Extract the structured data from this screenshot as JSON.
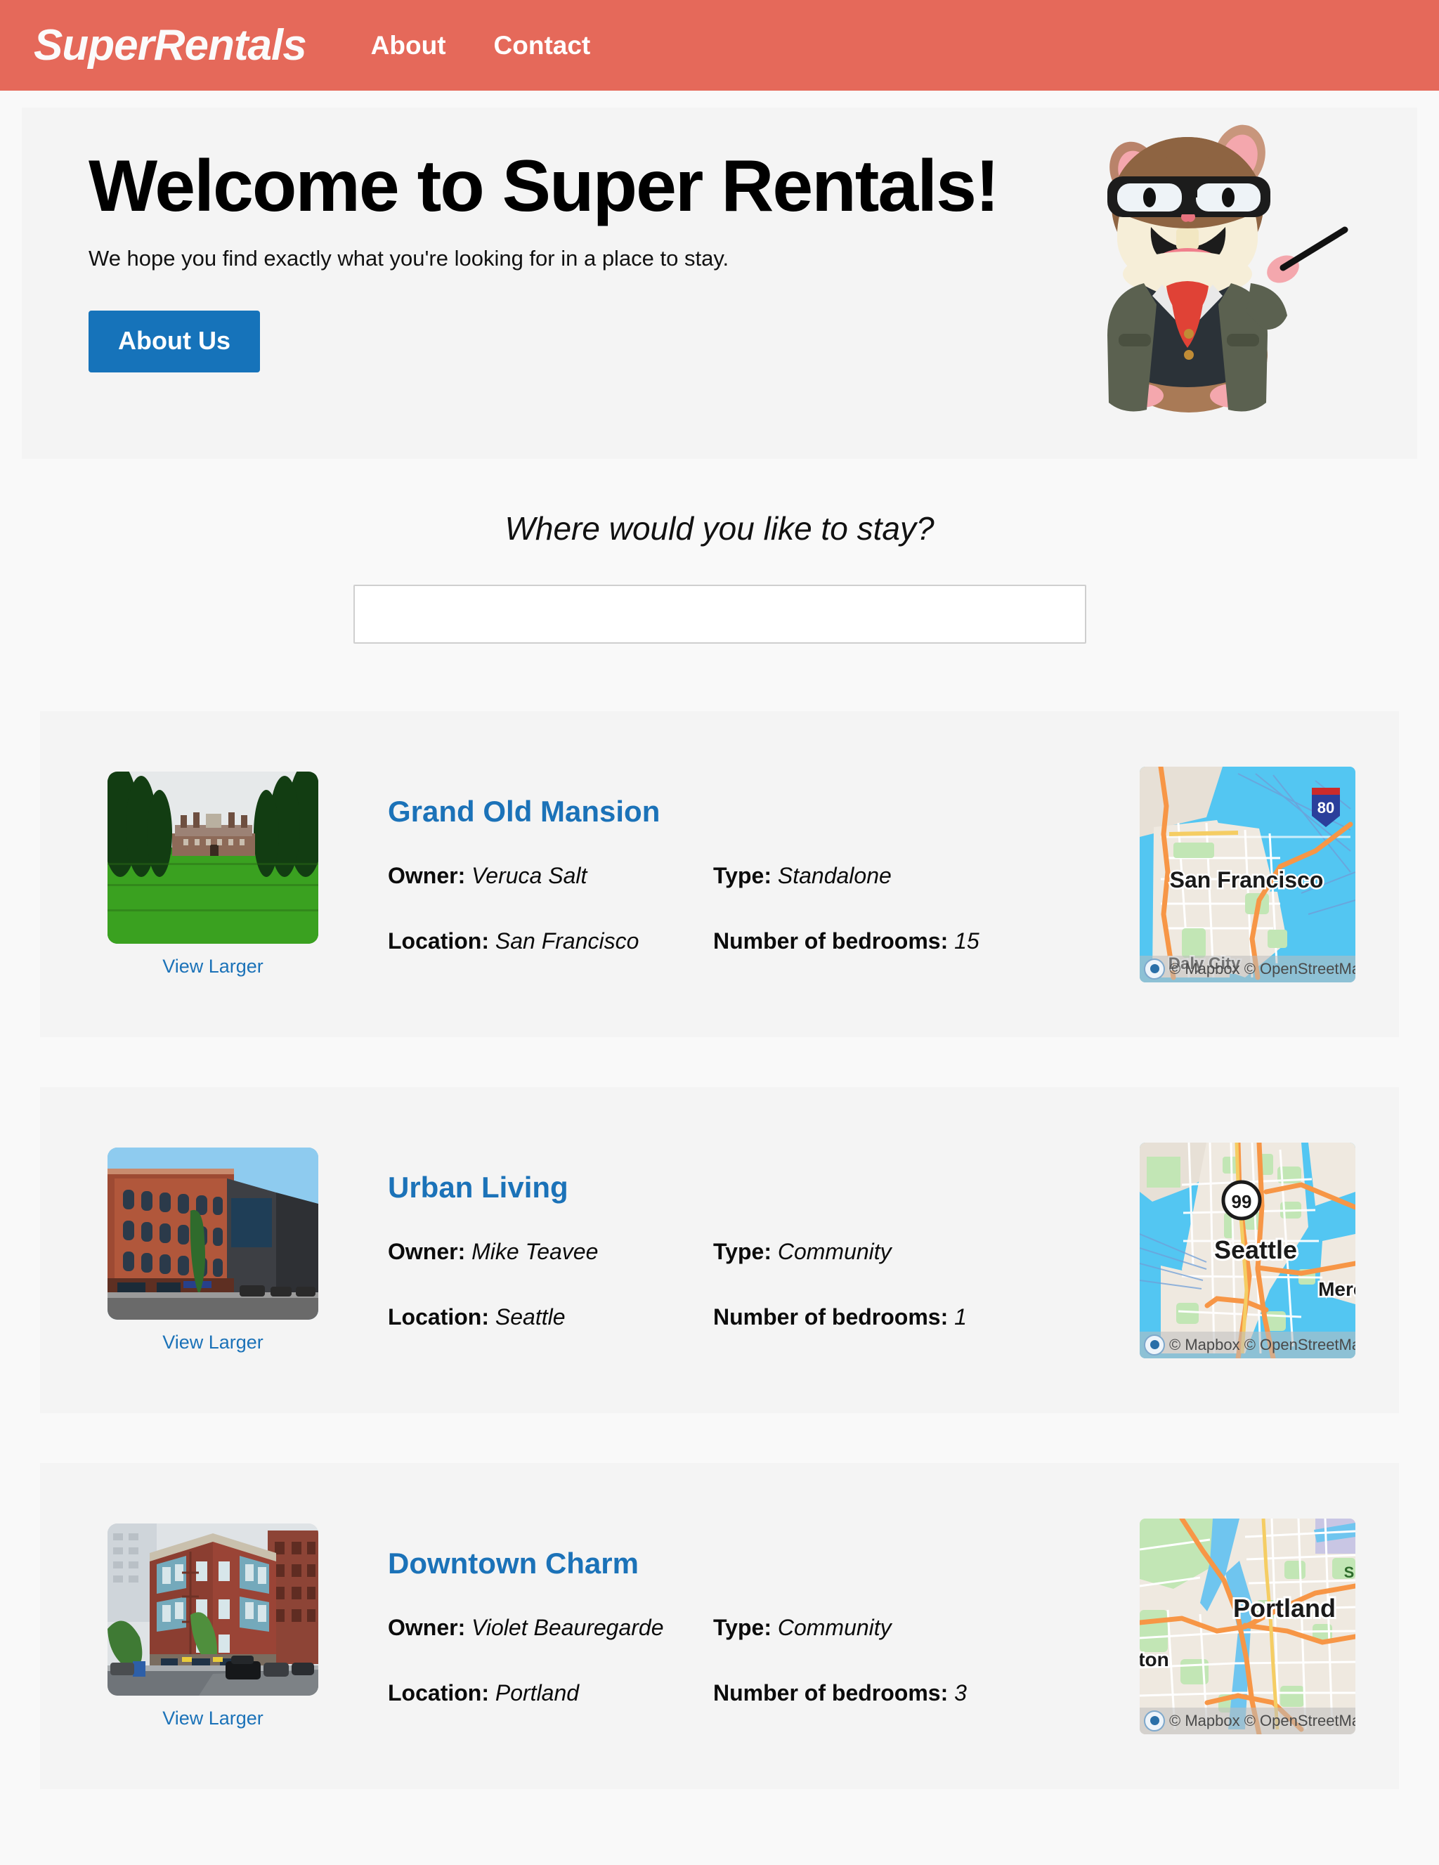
{
  "header": {
    "brand": "SuperRentals",
    "nav": [
      {
        "label": "About",
        "name": "nav-link-about"
      },
      {
        "label": "Contact",
        "name": "nav-link-contact"
      }
    ],
    "background_color": "#e5695a"
  },
  "hero": {
    "title": "Welcome to Super Rentals!",
    "subtitle": "We hope you find exactly what you're looking for in a place to stay.",
    "button_label": "About Us",
    "button_color": "#1673ba",
    "mascot": "tomster-hamster-mascot-icon"
  },
  "search": {
    "title": "Where would you like to stay?",
    "value": "",
    "placeholder": ""
  },
  "labels": {
    "owner": "Owner:",
    "type": "Type:",
    "location": "Location:",
    "bedrooms": "Number of bedrooms:",
    "view_larger": "View Larger",
    "map_attribution": "© Mapbox © OpenStreetMap"
  },
  "link_color": "#1b72b8",
  "rentals": [
    {
      "title": "Grand Old Mansion",
      "owner": "Veruca Salt",
      "type": "Standalone",
      "location": "San Francisco",
      "bedrooms": "15",
      "map_city": "San Francisco",
      "map_city_2": "Daly City",
      "map_shield": "80",
      "photo": "mansion-lawn-photo"
    },
    {
      "title": "Urban Living",
      "owner": "Mike Teavee",
      "type": "Community",
      "location": "Seattle",
      "bedrooms": "1",
      "map_city": "Seattle",
      "map_city_2": "Mercer",
      "map_shield": "99",
      "photo": "brick-building-photo"
    },
    {
      "title": "Downtown Charm",
      "owner": "Violet Beauregarde",
      "type": "Community",
      "location": "Portland",
      "bedrooms": "3",
      "map_city": "Portland",
      "map_city_2": "ton",
      "map_shield": "",
      "photo": "corner-apartment-photo"
    }
  ]
}
